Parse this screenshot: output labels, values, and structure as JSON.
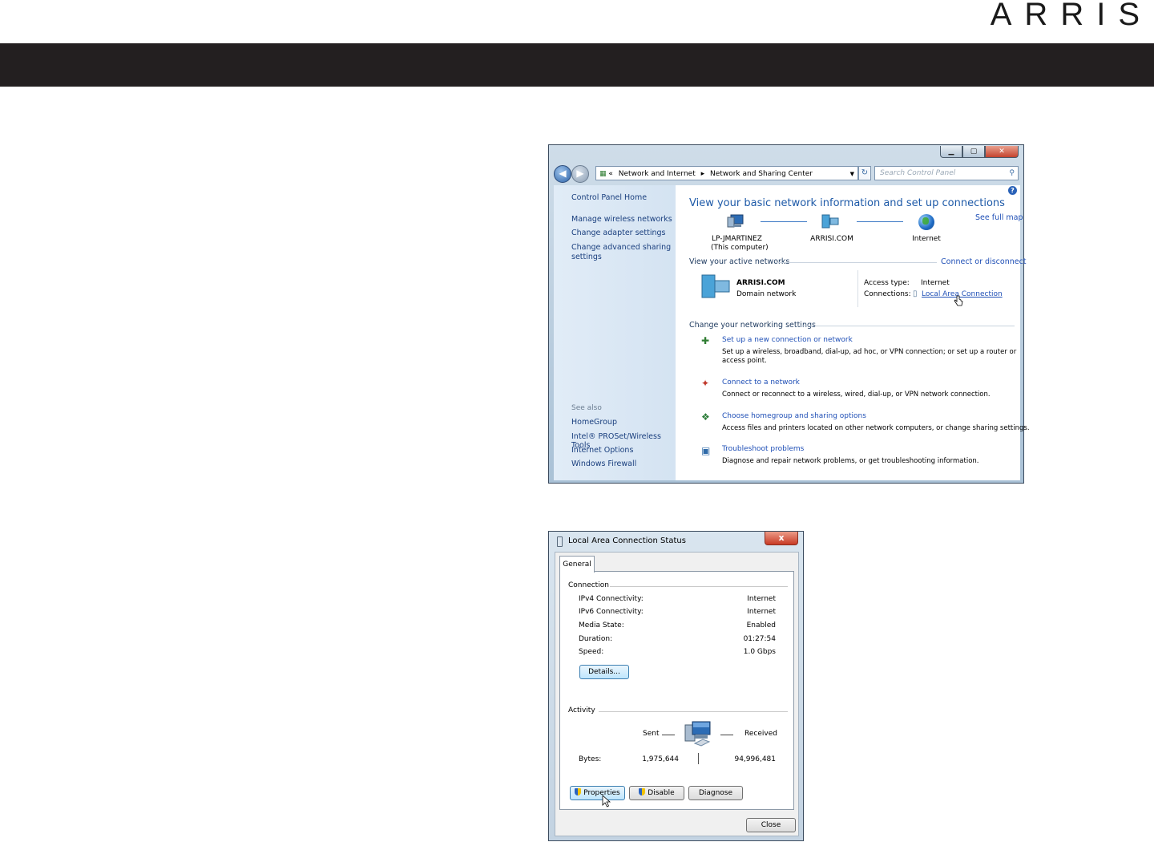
{
  "header": {
    "brand": "ARRIS",
    "brand_color": "#1a1a1a",
    "bar_color": "#231f20"
  },
  "nsc": {
    "address": {
      "prefix": "«",
      "crumb1": "Network and Internet",
      "sep": "▸",
      "crumb2": "Network and Sharing Center"
    },
    "search_placeholder": "Search Control Panel",
    "left": {
      "home": "Control Panel Home",
      "links": [
        "Manage wireless networks",
        "Change adapter settings",
        "Change advanced sharing",
        "settings"
      ],
      "see_also": "See also",
      "see_also_links": [
        "HomeGroup",
        "Intel® PROSet/Wireless Tools",
        "Internet Options",
        "Windows Firewall"
      ]
    },
    "main": {
      "heading": "View your basic network information and set up connections",
      "see_full_map": "See full map",
      "map": [
        {
          "name": "LP-JMARTINEZ",
          "sub": "(This computer)"
        },
        {
          "name": "ARRISI.COM",
          "sub": ""
        },
        {
          "name": "Internet",
          "sub": ""
        }
      ],
      "active_networks": "View your active networks",
      "connect_disconnect": "Connect or disconnect",
      "network_name": "ARRISI.COM",
      "network_type": "Domain network",
      "access_type_label": "Access type:",
      "access_type_value": "Internet",
      "connections_label": "Connections:",
      "connections_value": "Local Area Connection",
      "change_settings": "Change your networking settings",
      "tasks": [
        {
          "title": "Set up a new connection or network",
          "desc": "Set up a wireless, broadband, dial-up, ad hoc, or VPN connection; or set up a router or",
          "desc2": "access point."
        },
        {
          "title": "Connect to a network",
          "desc": "Connect or reconnect to a wireless, wired, dial-up, or VPN network connection.",
          "desc2": ""
        },
        {
          "title": "Choose homegroup and sharing options",
          "desc": "Access files and printers located on other network computers, or change sharing settings.",
          "desc2": ""
        },
        {
          "title": "Troubleshoot problems",
          "desc": "Diagnose and repair network problems, or get troubleshooting information.",
          "desc2": ""
        }
      ]
    }
  },
  "status": {
    "title": "Local Area Connection Status",
    "close_glyph": "x",
    "tab": "General",
    "connection_label": "Connection",
    "rows": [
      {
        "label": "IPv4 Connectivity:",
        "value": "Internet"
      },
      {
        "label": "IPv6 Connectivity:",
        "value": "Internet"
      },
      {
        "label": "Media State:",
        "value": "Enabled"
      },
      {
        "label": "Duration:",
        "value": "01:27:54"
      },
      {
        "label": "Speed:",
        "value": "1.0 Gbps"
      }
    ],
    "details_button": "Details...",
    "activity_label": "Activity",
    "sent_label": "Sent",
    "received_label": "Received",
    "bytes_label": "Bytes:",
    "bytes_sent": "1,975,644",
    "bytes_received": "94,996,481",
    "buttons": {
      "properties": "Properties",
      "disable": "Disable",
      "diagnose": "Diagnose",
      "close": "Close"
    }
  }
}
